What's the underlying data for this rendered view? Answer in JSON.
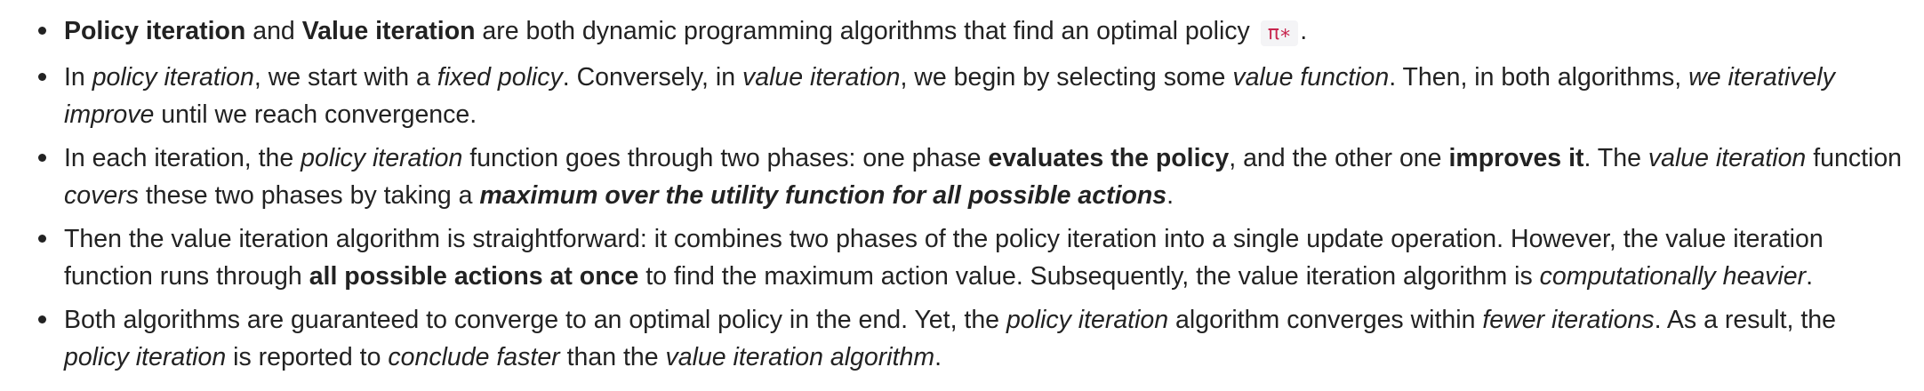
{
  "bullets": [
    {
      "segments": [
        {
          "text": "Policy iteration",
          "style": "b"
        },
        {
          "text": " and ",
          "style": ""
        },
        {
          "text": "Value iteration",
          "style": "b"
        },
        {
          "text": " are both dynamic programming algorithms that find an optimal policy ",
          "style": ""
        },
        {
          "text": "π∗",
          "style": "code"
        },
        {
          "text": ".",
          "style": ""
        }
      ]
    },
    {
      "segments": [
        {
          "text": "In ",
          "style": ""
        },
        {
          "text": "policy iteration",
          "style": "i"
        },
        {
          "text": ", we start with a ",
          "style": ""
        },
        {
          "text": "fixed policy",
          "style": "i"
        },
        {
          "text": ". Conversely, in ",
          "style": ""
        },
        {
          "text": "value iteration",
          "style": "i"
        },
        {
          "text": ", we begin by selecting some ",
          "style": ""
        },
        {
          "text": "value function",
          "style": "i"
        },
        {
          "text": ". Then, in both algorithms, ",
          "style": ""
        },
        {
          "text": "we iteratively improve",
          "style": "i"
        },
        {
          "text": " until we reach convergence.",
          "style": ""
        }
      ]
    },
    {
      "segments": [
        {
          "text": "In each iteration, the ",
          "style": ""
        },
        {
          "text": "policy iteration",
          "style": "i"
        },
        {
          "text": " function goes through two phases: one phase ",
          "style": ""
        },
        {
          "text": "evaluates the policy",
          "style": "b"
        },
        {
          "text": ", and the other one ",
          "style": ""
        },
        {
          "text": "improves it",
          "style": "b"
        },
        {
          "text": ". The ",
          "style": ""
        },
        {
          "text": "value iteration",
          "style": "i"
        },
        {
          "text": " function ",
          "style": ""
        },
        {
          "text": "covers",
          "style": "i"
        },
        {
          "text": " these two phases by taking a ",
          "style": ""
        },
        {
          "text": "maximum over the utility function for all possible actions",
          "style": "bi"
        },
        {
          "text": ".",
          "style": ""
        }
      ]
    },
    {
      "segments": [
        {
          "text": "Then the value iteration algorithm is straightforward: it combines two phases of the policy iteration into a single update operation. However, the value iteration function runs through ",
          "style": ""
        },
        {
          "text": "all possible actions at once",
          "style": "b"
        },
        {
          "text": " to find the maximum action value. Subsequently, the value iteration algorithm is ",
          "style": ""
        },
        {
          "text": "computationally heavier",
          "style": "i"
        },
        {
          "text": ".",
          "style": ""
        }
      ]
    },
    {
      "segments": [
        {
          "text": "Both algorithms are guaranteed to converge to an optimal policy in the end. Yet, the ",
          "style": ""
        },
        {
          "text": "policy iteration",
          "style": "i"
        },
        {
          "text": " algorithm converges within ",
          "style": ""
        },
        {
          "text": "fewer iterations",
          "style": "i"
        },
        {
          "text": ". As a result, the ",
          "style": ""
        },
        {
          "text": "policy iteration",
          "style": "i"
        },
        {
          "text": " is reported to ",
          "style": ""
        },
        {
          "text": "conclude faster",
          "style": "i"
        },
        {
          "text": " than the ",
          "style": ""
        },
        {
          "text": "value iteration algorithm",
          "style": "i"
        },
        {
          "text": ".",
          "style": ""
        }
      ]
    }
  ]
}
